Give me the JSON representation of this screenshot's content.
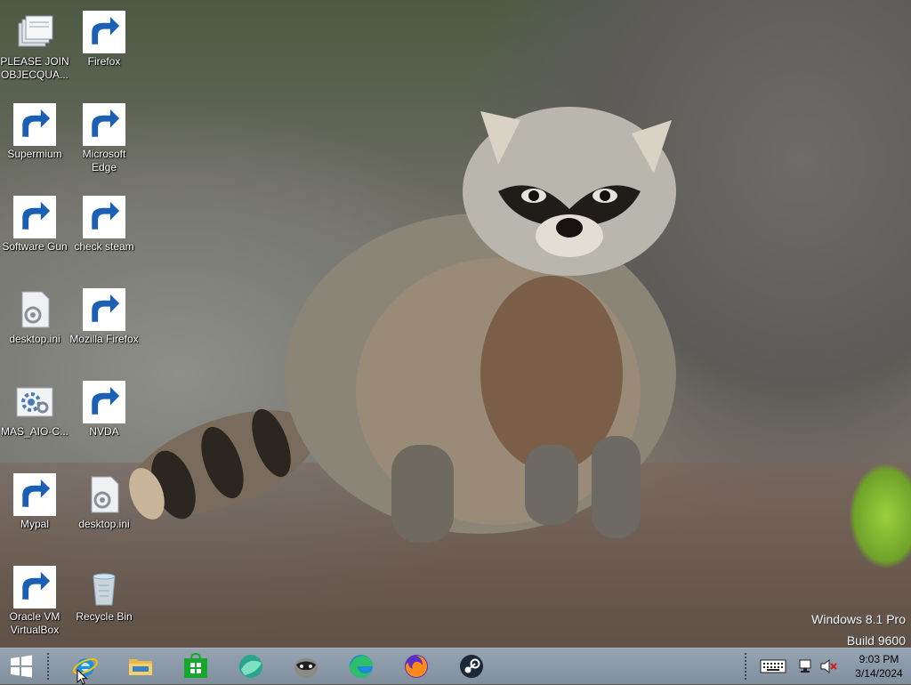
{
  "desktop": {
    "icons": [
      {
        "id": "please-join",
        "label": "PLEASE JOIN OBJECQUA...",
        "icon": "documents-stack-icon"
      },
      {
        "id": "firefox",
        "label": "Firefox",
        "icon": "firefox-icon",
        "shortcut": true
      },
      {
        "id": "supermium",
        "label": "Supermium",
        "icon": "supermium-icon",
        "shortcut": true
      },
      {
        "id": "microsoft-edge",
        "label": "Microsoft Edge",
        "icon": "edge-icon",
        "shortcut": true
      },
      {
        "id": "software-gun",
        "label": "Software Gun",
        "icon": "software-gun-icon",
        "shortcut": true
      },
      {
        "id": "check-steam",
        "label": "check steam",
        "icon": "steam-icon",
        "shortcut": true
      },
      {
        "id": "desktop-ini-1",
        "label": "desktop.ini",
        "icon": "settings-file-icon"
      },
      {
        "id": "mozilla-firefox",
        "label": "Mozilla Firefox",
        "icon": "firefox-icon",
        "shortcut": true
      },
      {
        "id": "mas-aio",
        "label": "MAS_AIO-C...",
        "icon": "settings-file-icon"
      },
      {
        "id": "nvda",
        "label": "NVDA",
        "icon": "nvda-icon",
        "shortcut": true
      },
      {
        "id": "mypal",
        "label": "Mypal",
        "icon": "mypal-icon",
        "shortcut": true
      },
      {
        "id": "desktop-ini-2",
        "label": "desktop.ini",
        "icon": "settings-file-icon"
      },
      {
        "id": "oracle-vm",
        "label": "Oracle VM VirtualBox",
        "icon": "virtualbox-icon",
        "shortcut": true
      },
      {
        "id": "recycle-bin",
        "label": "Recycle Bin",
        "icon": "recycle-bin-icon"
      }
    ]
  },
  "watermark": {
    "line1": "Windows 8.1 Pro",
    "line2": "Build 9600"
  },
  "taskbar": {
    "pinned": [
      {
        "id": "internet-explorer",
        "icon": "internet-explorer-icon"
      },
      {
        "id": "file-explorer",
        "icon": "folder-icon"
      },
      {
        "id": "store",
        "icon": "store-icon"
      },
      {
        "id": "supermium",
        "icon": "supermium-icon"
      },
      {
        "id": "mypal",
        "icon": "mypal-icon"
      },
      {
        "id": "edge",
        "icon": "edge-icon"
      },
      {
        "id": "firefox",
        "icon": "firefox-icon"
      },
      {
        "id": "steam",
        "icon": "steam-icon"
      }
    ],
    "tray": {
      "time": "9:03 PM",
      "date": "3/14/2024",
      "icons": [
        "keyboard-icon",
        "network-icon",
        "volume-muted-icon"
      ]
    }
  }
}
